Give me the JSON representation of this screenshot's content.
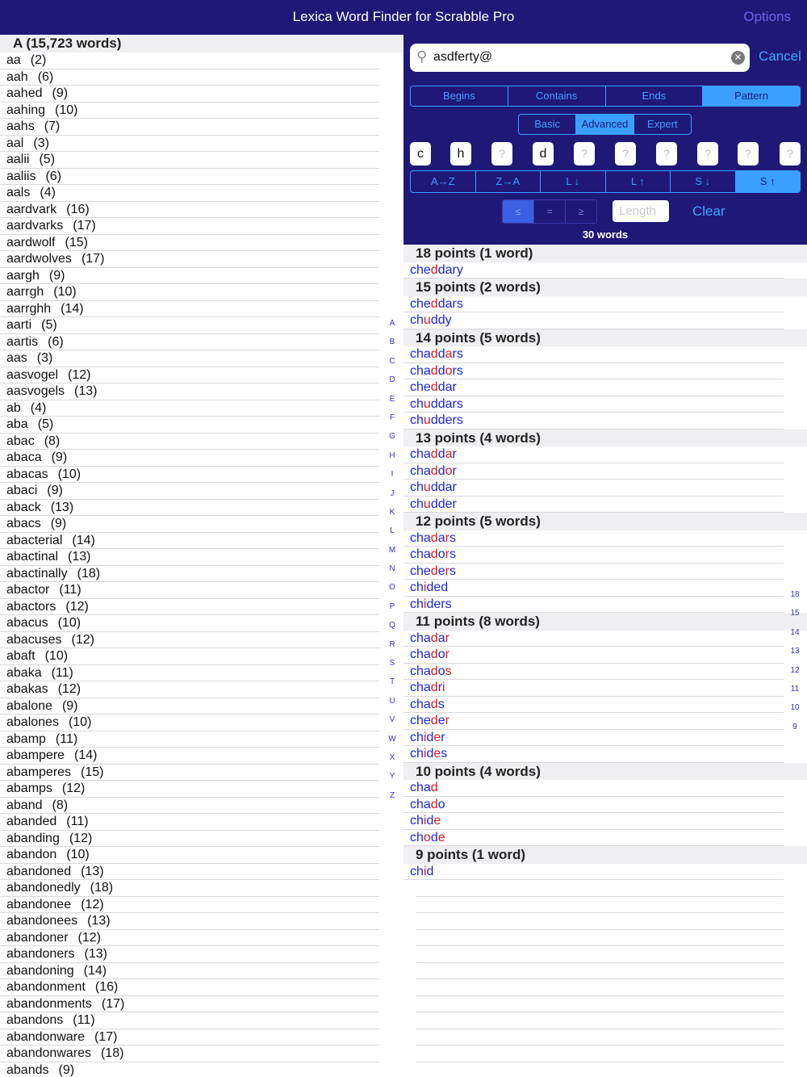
{
  "app": {
    "title": "Lexica Word Finder for Scrabble Pro",
    "options_label": "Options"
  },
  "left": {
    "section_title": "A (15,723 words)",
    "words": [
      {
        "w": "aa",
        "c": "(2)"
      },
      {
        "w": "aah",
        "c": "(6)"
      },
      {
        "w": "aahed",
        "c": "(9)"
      },
      {
        "w": "aahing",
        "c": "(10)"
      },
      {
        "w": "aahs",
        "c": "(7)"
      },
      {
        "w": "aal",
        "c": "(3)"
      },
      {
        "w": "aalii",
        "c": "(5)"
      },
      {
        "w": "aaliis",
        "c": "(6)"
      },
      {
        "w": "aals",
        "c": "(4)"
      },
      {
        "w": "aardvark",
        "c": "(16)"
      },
      {
        "w": "aardvarks",
        "c": "(17)"
      },
      {
        "w": "aardwolf",
        "c": "(15)"
      },
      {
        "w": "aardwolves",
        "c": "(17)"
      },
      {
        "w": "aargh",
        "c": "(9)"
      },
      {
        "w": "aarrgh",
        "c": "(10)"
      },
      {
        "w": "aarrghh",
        "c": "(14)"
      },
      {
        "w": "aarti",
        "c": "(5)"
      },
      {
        "w": "aartis",
        "c": "(6)"
      },
      {
        "w": "aas",
        "c": "(3)"
      },
      {
        "w": "aasvogel",
        "c": "(12)"
      },
      {
        "w": "aasvogels",
        "c": "(13)"
      },
      {
        "w": "ab",
        "c": "(4)"
      },
      {
        "w": "aba",
        "c": "(5)"
      },
      {
        "w": "abac",
        "c": "(8)"
      },
      {
        "w": "abaca",
        "c": "(9)"
      },
      {
        "w": "abacas",
        "c": "(10)"
      },
      {
        "w": "abaci",
        "c": "(9)"
      },
      {
        "w": "aback",
        "c": "(13)"
      },
      {
        "w": "abacs",
        "c": "(9)"
      },
      {
        "w": "abacterial",
        "c": "(14)"
      },
      {
        "w": "abactinal",
        "c": "(13)"
      },
      {
        "w": "abactinally",
        "c": "(18)"
      },
      {
        "w": "abactor",
        "c": "(11)"
      },
      {
        "w": "abactors",
        "c": "(12)"
      },
      {
        "w": "abacus",
        "c": "(10)"
      },
      {
        "w": "abacuses",
        "c": "(12)"
      },
      {
        "w": "abaft",
        "c": "(10)"
      },
      {
        "w": "abaka",
        "c": "(11)"
      },
      {
        "w": "abakas",
        "c": "(12)"
      },
      {
        "w": "abalone",
        "c": "(9)"
      },
      {
        "w": "abalones",
        "c": "(10)"
      },
      {
        "w": "abamp",
        "c": "(11)"
      },
      {
        "w": "abampere",
        "c": "(14)"
      },
      {
        "w": "abamperes",
        "c": "(15)"
      },
      {
        "w": "abamps",
        "c": "(12)"
      },
      {
        "w": "aband",
        "c": "(8)"
      },
      {
        "w": "abanded",
        "c": "(11)"
      },
      {
        "w": "abanding",
        "c": "(12)"
      },
      {
        "w": "abandon",
        "c": "(10)"
      },
      {
        "w": "abandoned",
        "c": "(13)"
      },
      {
        "w": "abandonedly",
        "c": "(18)"
      },
      {
        "w": "abandonee",
        "c": "(12)"
      },
      {
        "w": "abandonees",
        "c": "(13)"
      },
      {
        "w": "abandoner",
        "c": "(12)"
      },
      {
        "w": "abandoners",
        "c": "(13)"
      },
      {
        "w": "abandoning",
        "c": "(14)"
      },
      {
        "w": "abandonment",
        "c": "(16)"
      },
      {
        "w": "abandonments",
        "c": "(17)"
      },
      {
        "w": "abandons",
        "c": "(11)"
      },
      {
        "w": "abandonware",
        "c": "(17)"
      },
      {
        "w": "abandonwares",
        "c": "(18)"
      },
      {
        "w": "abands",
        "c": "(9)"
      }
    ],
    "alphabet": [
      "A",
      "B",
      "C",
      "D",
      "E",
      "F",
      "G",
      "H",
      "I",
      "J",
      "K",
      "L",
      "M",
      "N",
      "O",
      "P",
      "Q",
      "R",
      "S",
      "T",
      "U",
      "V",
      "W",
      "X",
      "Y",
      "Z"
    ]
  },
  "search": {
    "value": "asdferty@",
    "search_icon": "magnifier-icon",
    "clear_icon": "clear-icon",
    "cancel_label": "Cancel"
  },
  "mode_tabs": [
    {
      "label": "Begins",
      "selected": false
    },
    {
      "label": "Contains",
      "selected": false
    },
    {
      "label": "Ends",
      "selected": false
    },
    {
      "label": "Pattern",
      "selected": true
    }
  ],
  "level_tabs": [
    {
      "label": "Basic",
      "selected": false
    },
    {
      "label": "Advanced",
      "selected": true
    },
    {
      "label": "Expert",
      "selected": false
    }
  ],
  "pattern_tiles": [
    "c",
    "h",
    "?",
    "d",
    "?",
    "?",
    "?",
    "?",
    "?",
    "?"
  ],
  "sort_tabs": [
    {
      "label": "A→Z",
      "selected": false
    },
    {
      "label": "Z→A",
      "selected": false
    },
    {
      "label": "L ↓",
      "selected": false
    },
    {
      "label": "L ↑",
      "selected": false
    },
    {
      "label": "S ↓",
      "selected": false
    },
    {
      "label": "S ↑",
      "selected": true
    }
  ],
  "length_filter": {
    "compare": [
      {
        "label": "≤",
        "selected": true
      },
      {
        "label": "=",
        "selected": false
      },
      {
        "label": "≥",
        "selected": false
      }
    ],
    "placeholder": "Length",
    "clear_label": "Clear"
  },
  "result_count": "30 words",
  "results": [
    {
      "header": "18 points (1 word)",
      "words": [
        [
          "che",
          "d",
          "dary"
        ]
      ]
    },
    {
      "header": "15 points (2 words)",
      "words": [
        [
          "che",
          "d",
          "dars"
        ],
        [
          "ch",
          "u",
          "ddy"
        ]
      ]
    },
    {
      "header": "14 points (5 words)",
      "words": [
        [
          "cha",
          "d",
          "d",
          "a",
          "rs"
        ],
        [
          "cha",
          "d",
          "d",
          "o",
          "rs"
        ],
        [
          "che",
          "d",
          "dar"
        ],
        [
          "ch",
          "u",
          "ddars"
        ],
        [
          "ch",
          "u",
          "dders"
        ]
      ]
    },
    {
      "header": "13 points (4 words)",
      "words": [
        [
          "cha",
          "d",
          "d",
          "a",
          "r"
        ],
        [
          "cha",
          "d",
          "d",
          "o",
          "r"
        ],
        [
          "ch",
          "u",
          "ddar"
        ],
        [
          "ch",
          "u",
          "dder"
        ]
      ]
    },
    {
      "header": "12 points (5 words)",
      "words": [
        [
          "cha",
          "d",
          "a",
          "r",
          "s"
        ],
        [
          "cha",
          "d",
          "o",
          "r",
          "s"
        ],
        [
          "che",
          "d",
          "e",
          "r",
          "s"
        ],
        [
          "ch",
          "i",
          "ded"
        ],
        [
          "ch",
          "i",
          "ders"
        ]
      ]
    },
    {
      "header": "11 points (8 words)",
      "words": [
        [
          "cha",
          "d",
          "a",
          "r"
        ],
        [
          "cha",
          "d",
          "o",
          "r"
        ],
        [
          "cha",
          "d",
          "o",
          "s"
        ],
        [
          "cha",
          "d",
          "r",
          "i"
        ],
        [
          "cha",
          "d",
          "s"
        ],
        [
          "che",
          "d",
          "e",
          "r"
        ],
        [
          "ch",
          "i",
          "d",
          "e",
          "r"
        ],
        [
          "ch",
          "i",
          "d",
          "e",
          "s"
        ]
      ]
    },
    {
      "header": "10 points (4 words)",
      "words": [
        [
          "cha",
          "d"
        ],
        [
          "cha",
          "d",
          "o"
        ],
        [
          "ch",
          "i",
          "d",
          "e"
        ],
        [
          "ch",
          "o",
          "d",
          "e"
        ]
      ]
    },
    {
      "header": "9 points (1 word)",
      "words": [
        [
          "ch",
          "i",
          "d"
        ]
      ]
    }
  ],
  "points_index": [
    "18",
    "15",
    "14",
    "13",
    "12",
    "11",
    "10",
    "9"
  ]
}
